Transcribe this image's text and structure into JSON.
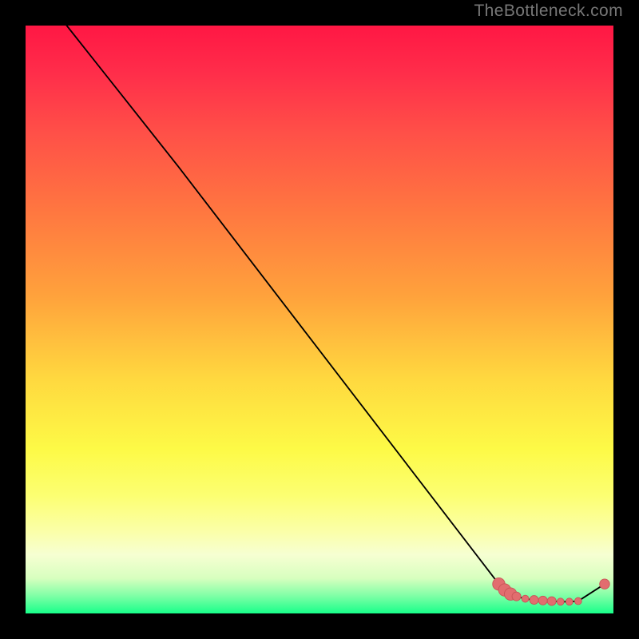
{
  "watermark": "TheBottleneck.com",
  "colors": {
    "page_bg": "#000000",
    "line": "#000000",
    "marker_fill": "#e26d6f",
    "marker_stroke": "#c85557"
  },
  "chart_data": {
    "type": "line",
    "title": "",
    "xlabel": "",
    "ylabel": "",
    "xlim": [
      0,
      100
    ],
    "ylim": [
      0,
      100
    ],
    "grid": false,
    "series": [
      {
        "name": "bottleneck-curve",
        "x": [
          7,
          26,
          80.5,
          81.5,
          82.5,
          83.5,
          85,
          86.5,
          88,
          89.5,
          91,
          92.5,
          94,
          98.5
        ],
        "y": [
          100,
          76,
          5.0,
          4.0,
          3.3,
          2.9,
          2.5,
          2.3,
          2.2,
          2.1,
          2.0,
          2.0,
          2.1,
          5.0
        ]
      }
    ],
    "markers": [
      {
        "name": "point-a",
        "x": 80.5,
        "y": 5.0,
        "r": 1.05
      },
      {
        "name": "point-b",
        "x": 81.5,
        "y": 4.0,
        "r": 1.05
      },
      {
        "name": "point-c",
        "x": 82.5,
        "y": 3.3,
        "r": 1.05
      },
      {
        "name": "point-d",
        "x": 83.5,
        "y": 2.9,
        "r": 0.75
      },
      {
        "name": "point-e",
        "x": 85.0,
        "y": 2.5,
        "r": 0.6
      },
      {
        "name": "point-f",
        "x": 86.5,
        "y": 2.3,
        "r": 0.75
      },
      {
        "name": "point-g",
        "x": 88.0,
        "y": 2.2,
        "r": 0.75
      },
      {
        "name": "point-h",
        "x": 89.5,
        "y": 2.1,
        "r": 0.75
      },
      {
        "name": "point-i",
        "x": 91.0,
        "y": 2.0,
        "r": 0.6
      },
      {
        "name": "point-j",
        "x": 92.5,
        "y": 2.0,
        "r": 0.6
      },
      {
        "name": "point-k",
        "x": 94.0,
        "y": 2.1,
        "r": 0.6
      },
      {
        "name": "point-end",
        "x": 98.5,
        "y": 5.0,
        "r": 0.85
      }
    ]
  }
}
